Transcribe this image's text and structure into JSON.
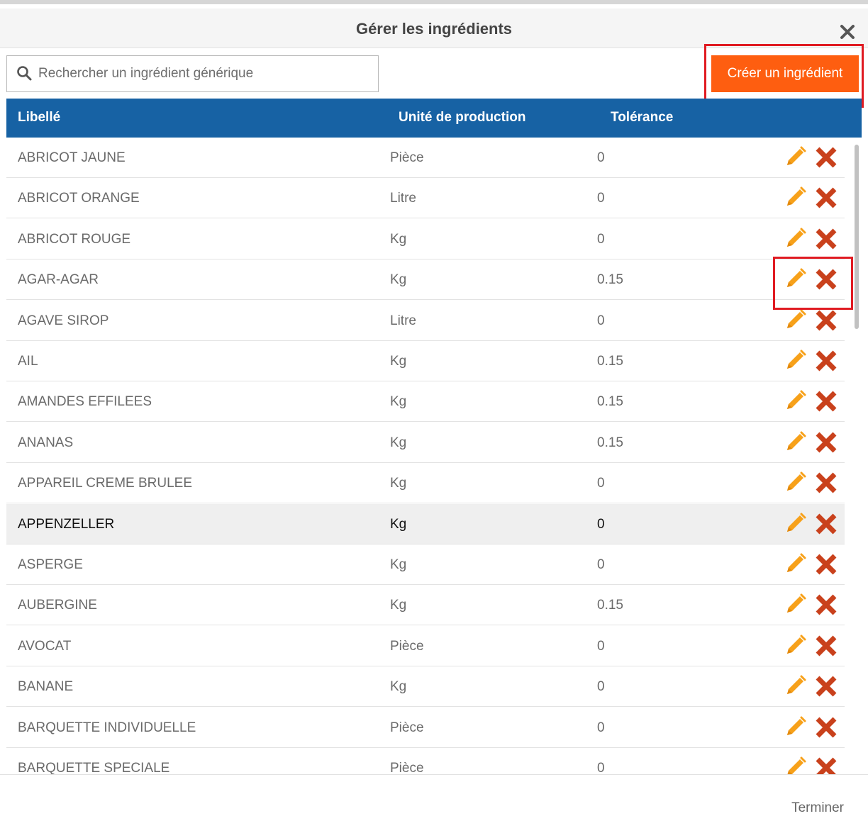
{
  "dialog": {
    "title": "Gérer les ingrédients",
    "close_icon": "close-icon"
  },
  "search": {
    "placeholder": "Rechercher un ingrédient générique",
    "value": "",
    "icon": "search-icon"
  },
  "create_button": {
    "label": "Créer un ingrédient",
    "color": "#fe5e10"
  },
  "table": {
    "header_color": "#1762a4",
    "columns": [
      "Libellé",
      "Unité de production",
      "Tolérance"
    ],
    "rows": [
      {
        "name": "ABRICOT JAUNE",
        "unit": "Pièce",
        "tolerance": "0"
      },
      {
        "name": "ABRICOT ORANGE",
        "unit": "Litre",
        "tolerance": "0"
      },
      {
        "name": "ABRICOT ROUGE",
        "unit": "Kg",
        "tolerance": "0"
      },
      {
        "name": "AGAR-AGAR",
        "unit": "Kg",
        "tolerance": "0.15"
      },
      {
        "name": "AGAVE SIROP",
        "unit": "Litre",
        "tolerance": "0"
      },
      {
        "name": "AIL",
        "unit": "Kg",
        "tolerance": "0.15"
      },
      {
        "name": "AMANDES EFFILEES",
        "unit": "Kg",
        "tolerance": "0.15"
      },
      {
        "name": "ANANAS",
        "unit": "Kg",
        "tolerance": "0.15"
      },
      {
        "name": "APPAREIL CREME BRULEE",
        "unit": "Kg",
        "tolerance": "0"
      },
      {
        "name": "APPENZELLER",
        "unit": "Kg",
        "tolerance": "0",
        "selected": true
      },
      {
        "name": "ASPERGE",
        "unit": "Kg",
        "tolerance": "0"
      },
      {
        "name": "AUBERGINE",
        "unit": "Kg",
        "tolerance": "0.15"
      },
      {
        "name": "AVOCAT",
        "unit": "Pièce",
        "tolerance": "0"
      },
      {
        "name": "BANANE",
        "unit": "Kg",
        "tolerance": "0"
      },
      {
        "name": "BARQUETTE INDIVIDUELLE",
        "unit": "Pièce",
        "tolerance": "0"
      },
      {
        "name": "BARQUETTE SPECIALE",
        "unit": "Pièce",
        "tolerance": "0"
      }
    ],
    "row_action_icons": [
      "pencil-icon",
      "delete-x-icon"
    ],
    "edit_icon_color": "#f7a11a",
    "delete_icon_color": "#c9411c"
  },
  "highlight_color": "#e01b22",
  "footer": {
    "finish_label": "Terminer"
  }
}
